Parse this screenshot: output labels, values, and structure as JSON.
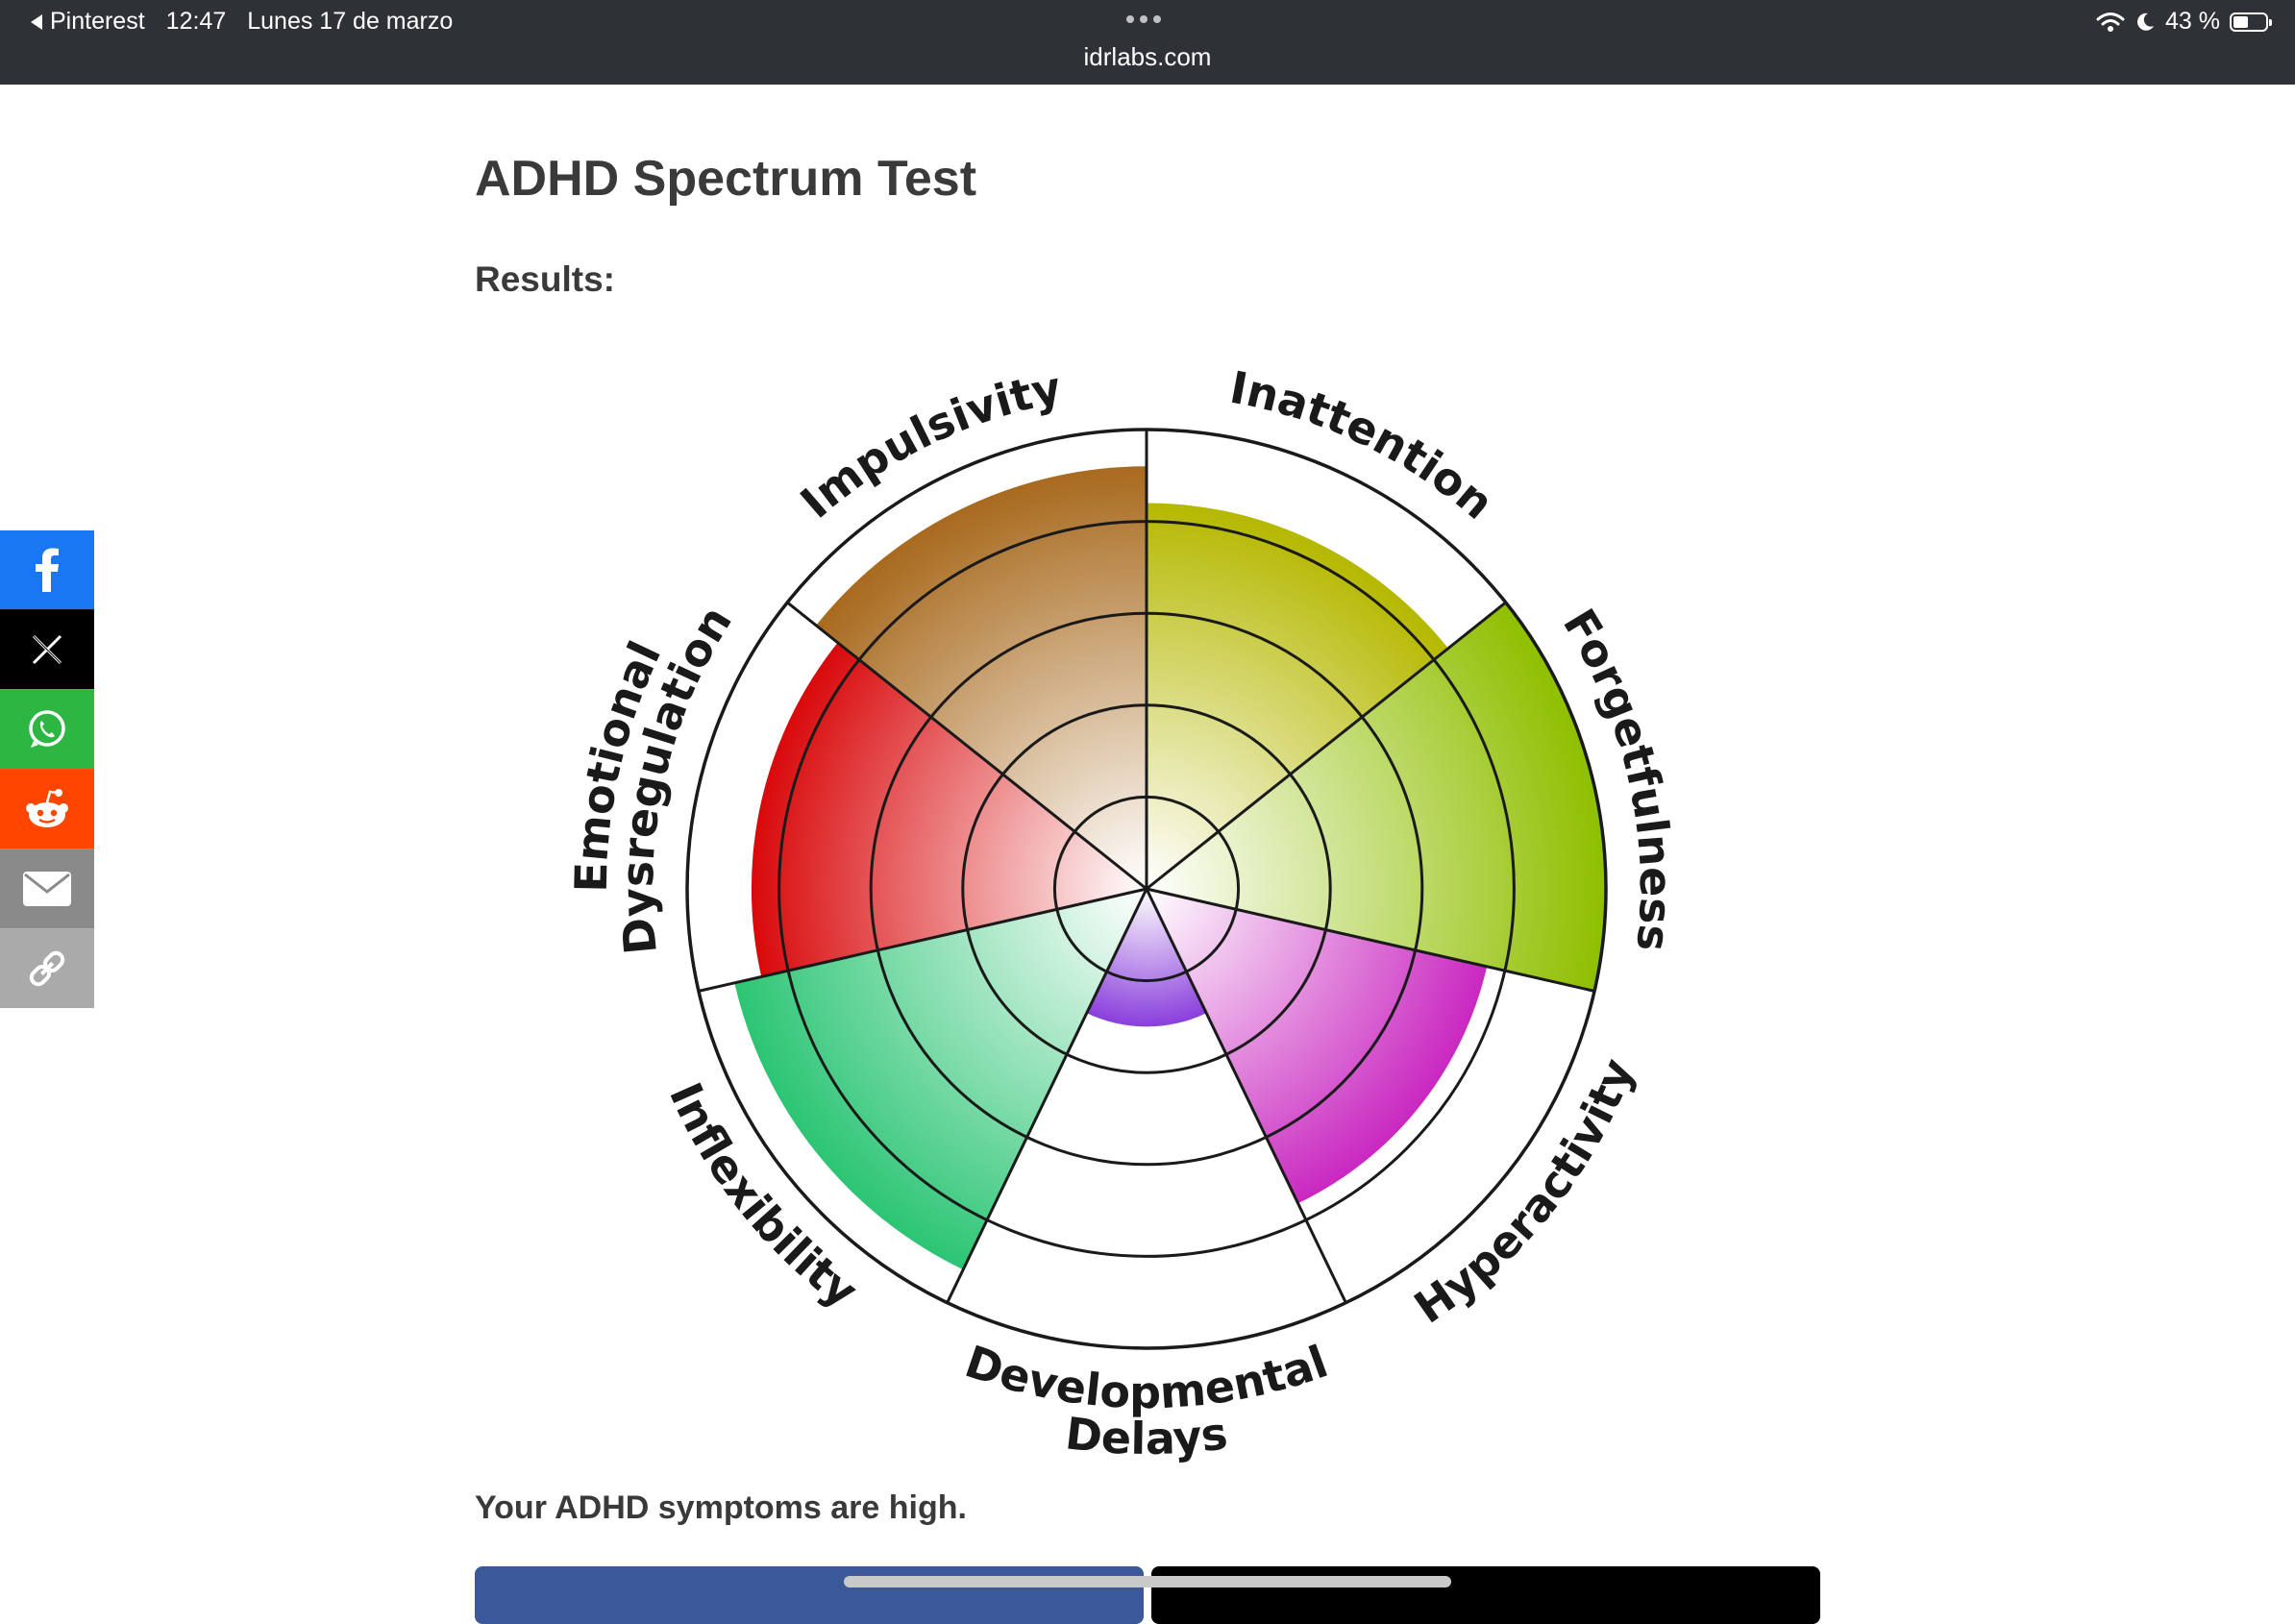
{
  "status_bar": {
    "back_app": "Pinterest",
    "time": "12:47",
    "date": "Lunes 17 de marzo",
    "url": "idrlabs.com",
    "battery": "43 %"
  },
  "page": {
    "title": "ADHD Spectrum Test",
    "results_label": "Results:",
    "summary": "Your ADHD symptoms are high."
  },
  "share_buttons": [
    {
      "name": "facebook",
      "color": "#1877f2"
    },
    {
      "name": "x",
      "color": "#000000"
    },
    {
      "name": "whatsapp",
      "color": "#2db742"
    },
    {
      "name": "reddit",
      "color": "#ff4500"
    },
    {
      "name": "email",
      "color": "#8a8a8a"
    },
    {
      "name": "copy-link",
      "color": "#aaaaaa"
    }
  ],
  "chart_data": {
    "type": "polar-area",
    "scale_max": 5,
    "grid_rings": 4,
    "categories": [
      {
        "label": "Inattention",
        "value": 4.2,
        "color": "#b5b800"
      },
      {
        "label": "Forgetfulness",
        "value": 5.0,
        "color": "#8fbf00"
      },
      {
        "label": "Hyperactivity",
        "value": 3.8,
        "color": "#c928c0"
      },
      {
        "label": "Developmental Delays",
        "value": 1.5,
        "color": "#8a3fdc"
      },
      {
        "label": "Inflexibility",
        "value": 4.6,
        "color": "#2cc574"
      },
      {
        "label": "Emotional Dysregulation",
        "value": 4.3,
        "color": "#d9090b"
      },
      {
        "label": "Impulsivity",
        "value": 4.6,
        "color": "#a86a1e"
      }
    ]
  }
}
